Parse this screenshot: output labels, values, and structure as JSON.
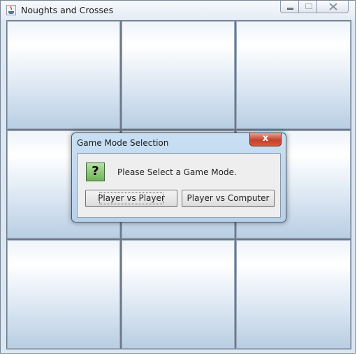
{
  "window": {
    "title": "Noughts and Crosses",
    "icons": [
      "java-app-icon",
      "minimize-icon",
      "maximize-icon",
      "close-icon"
    ]
  },
  "board": {
    "rows": 3,
    "columns": 3,
    "cells": [
      "",
      "",
      "",
      "",
      "",
      "",
      "",
      "",
      ""
    ]
  },
  "dialog": {
    "title": "Game Mode Selection",
    "icon": "question-icon",
    "icon_glyph": "?",
    "message": "Please Select a Game Mode.",
    "close_glyph": "x",
    "buttons": {
      "player_vs_player": "Player vs Player",
      "player_vs_computer": "Player vs Computer"
    }
  },
  "colors": {
    "cell_gradient_top": "#ffffff",
    "cell_gradient_bottom": "#b9cee3",
    "dialog_frame": "#c9dff3",
    "close_button": "#c4412b",
    "question_icon": "#6fb158"
  }
}
